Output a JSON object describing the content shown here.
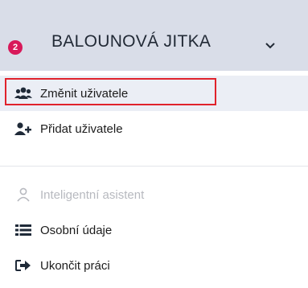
{
  "header": {
    "notification_count": "2",
    "user_name": "BALOUNOVÁ JITKA"
  },
  "menu": {
    "items": [
      {
        "label": "Změnit uživatele",
        "icon": "users-icon"
      },
      {
        "label": "Přidat uživatele",
        "icon": "user-plus-icon"
      },
      {
        "label": "Inteligentní asistent",
        "icon": "user-outline-icon"
      },
      {
        "label": "Osobní údaje",
        "icon": "list-icon"
      },
      {
        "label": "Ukončit práci",
        "icon": "sign-out-icon"
      }
    ]
  },
  "colors": {
    "header_bg": "#d9dde8",
    "badge": "#d8195a",
    "focus_outline": "#e0222b",
    "disabled_text": "#b7b9bf"
  }
}
